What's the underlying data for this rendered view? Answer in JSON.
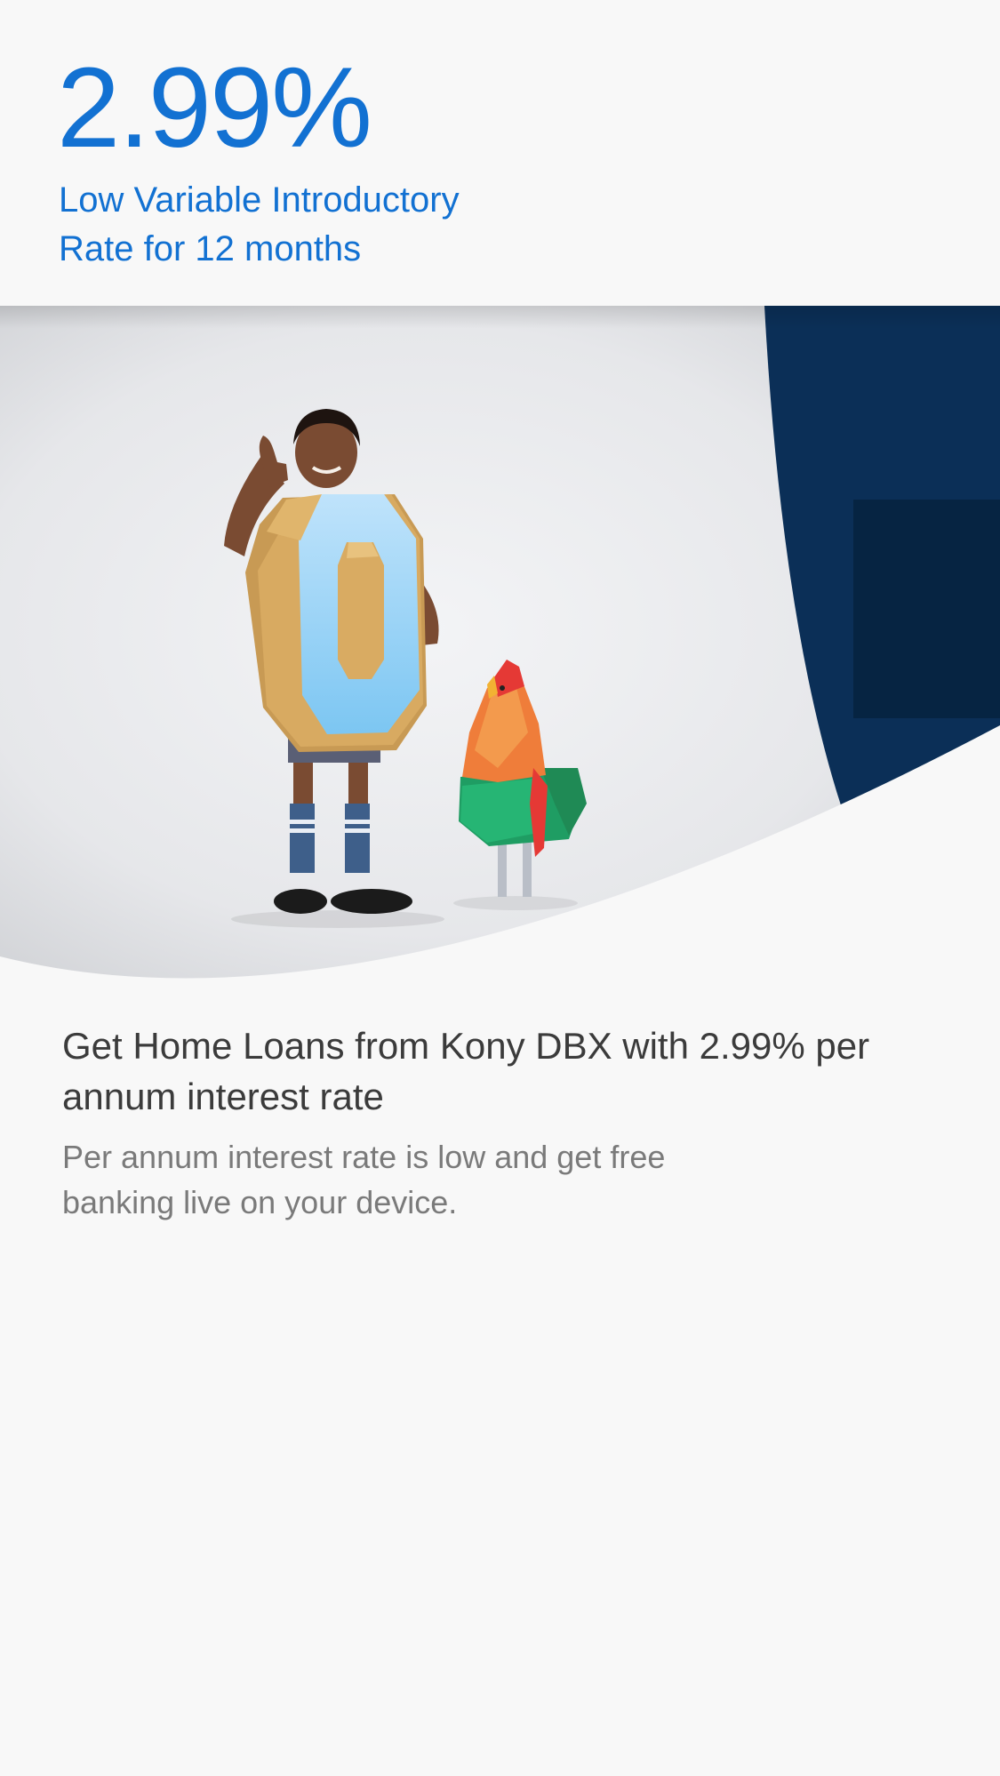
{
  "promo": {
    "rate": "2.99%",
    "rate_description": "Low Variable Introductory Rate for 12 months"
  },
  "hero_image": {
    "icons": [
      "boy-with-zero-costume-illustration",
      "paper-rooster-illustration"
    ]
  },
  "offer": {
    "title": "Get Home Loans from Kony DBX with 2.99% per annum interest rate",
    "description": "Per annum interest rate is low and get free banking live on your device."
  },
  "colors": {
    "accent_blue": "#1271d2",
    "navy": "#0b2f57",
    "background": "#f8f8f8",
    "title_text": "#3b3b3b",
    "body_text": "#7a7a7a"
  }
}
